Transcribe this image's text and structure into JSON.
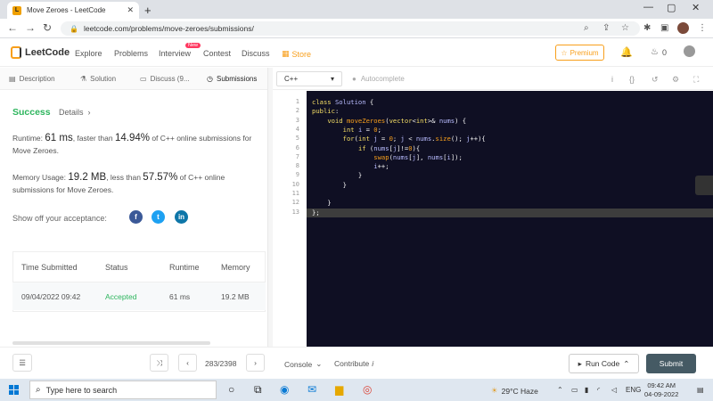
{
  "browser": {
    "tab_title": "Move Zeroes - LeetCode",
    "tab_favicon": "L",
    "url": "leetcode.com/problems/move-zeroes/submissions/"
  },
  "nav": {
    "logo": "LeetCode",
    "links": [
      "Explore",
      "Problems",
      "Interview",
      "Contest",
      "Discuss",
      "Store"
    ],
    "new_badge": "New",
    "premium": "Premium",
    "fire_count": "0"
  },
  "left_tabs": [
    "Description",
    "Solution",
    "Discuss (9...",
    "Submissions"
  ],
  "result": {
    "status": "Success",
    "details": "Details",
    "runtime_label": "Runtime: ",
    "runtime_value": "61 ms",
    "runtime_mid": ", faster than ",
    "runtime_pct": "14.94%",
    "runtime_tail": " of C++ online submissions for Move Zeroes.",
    "memory_label": "Memory Usage: ",
    "memory_value": "19.2 MB",
    "memory_mid": ", less than ",
    "memory_pct": "57.57%",
    "memory_tail": " of C++ online submissions for Move Zeroes.",
    "share": "Show off your acceptance:"
  },
  "table": {
    "headers": [
      "Time Submitted",
      "Status",
      "Runtime",
      "Memory"
    ],
    "row": [
      "09/04/2022 09:42",
      "Accepted",
      "61 ms",
      "19.2 MB"
    ]
  },
  "editor": {
    "language": "C++",
    "autocomplete": "Autocomplete",
    "line_numbers": [
      "1",
      "2",
      "3",
      "4",
      "5",
      "6",
      "7",
      "8",
      "9",
      "10",
      "11",
      "12",
      "13"
    ]
  },
  "bottom": {
    "pager": "283/2398",
    "console": "Console",
    "contribute": "Contribute",
    "run_code": "Run Code",
    "submit": "Submit"
  },
  "taskbar": {
    "search_placeholder": "Type here to search",
    "weather": "29°C  Haze",
    "lang": "ENG",
    "time": "09:42 AM",
    "date": "04-09-2022"
  }
}
